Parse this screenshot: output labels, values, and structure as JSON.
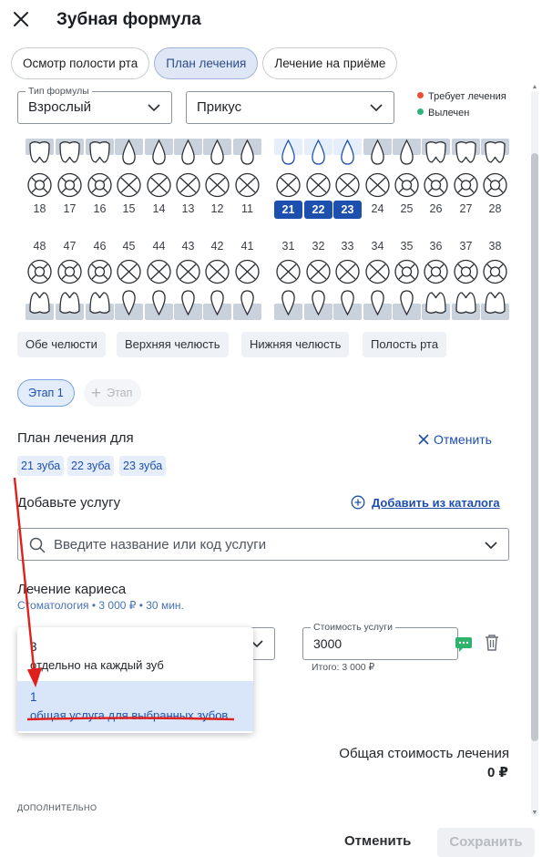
{
  "header": {
    "title": "Зубная формула"
  },
  "tabs": [
    {
      "label": "Осмотр полости рта",
      "active": false
    },
    {
      "label": "План лечения",
      "active": true
    },
    {
      "label": "Лечение на приёме",
      "active": false
    }
  ],
  "formula": {
    "type_label": "Тип формулы",
    "type_value": "Взрослый",
    "bite_value": "Прикус",
    "legend": [
      {
        "label": "Требует лечения",
        "color": "#e8503a"
      },
      {
        "label": "Вылечен",
        "color": "#2db37a"
      }
    ]
  },
  "teeth": {
    "upper": [
      "18",
      "17",
      "16",
      "15",
      "14",
      "13",
      "12",
      "11",
      "21",
      "22",
      "23",
      "24",
      "25",
      "26",
      "27",
      "28"
    ],
    "lower": [
      "48",
      "47",
      "46",
      "45",
      "44",
      "43",
      "42",
      "41",
      "31",
      "32",
      "33",
      "34",
      "35",
      "36",
      "37",
      "38"
    ],
    "selected": [
      "21",
      "22",
      "23"
    ]
  },
  "jaw_buttons": [
    "Обе челюсти",
    "Верхняя челюсть",
    "Нижняя челюсть",
    "Полость рта"
  ],
  "stages": {
    "stage": "Этап 1",
    "add": "Этап"
  },
  "plan": {
    "title": "План лечения для",
    "cancel": "Отменить",
    "teeth_chips": [
      "21 зуба",
      "22 зуба",
      "23 зуба"
    ]
  },
  "service": {
    "add_label": "Добавьте услугу",
    "catalog_link": "Добавить из каталога",
    "search_placeholder": "Введите название или код услуги",
    "name": "Лечение кариеса",
    "meta": "Стоматология • 3 000 ₽ • 30 мин.",
    "cost_label": "Стоимость услуги",
    "cost_value": "3000",
    "total_line": "Итого: 3 000 ₽"
  },
  "popup": [
    {
      "count": "3",
      "desc": "отдельно на каждый зуб",
      "selected": false
    },
    {
      "count": "1",
      "desc": "общая услуга для выбранных зубов",
      "selected": true
    }
  ],
  "totals": {
    "label": "Общая стоимость лечения",
    "value": "0 ₽"
  },
  "extra_label": "ДОПОЛНИТЕЛЬНО",
  "footer": {
    "cancel": "Отменить",
    "save": "Сохранить"
  },
  "colors": {
    "accent": "#1d4fae",
    "annotation": "#e0201c"
  }
}
